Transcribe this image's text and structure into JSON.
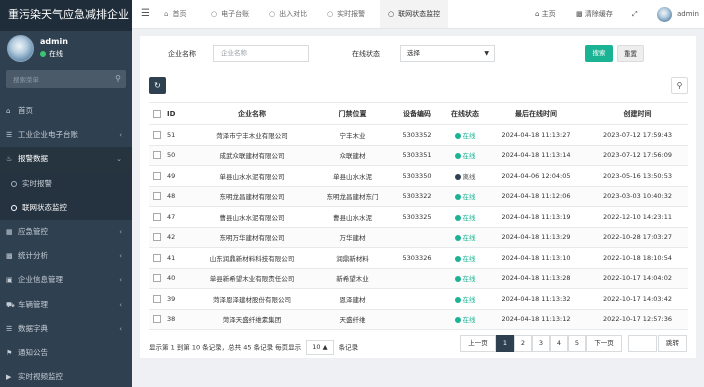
{
  "app": {
    "title": "重污染天气应急减排企业",
    "user": {
      "name": "admin",
      "status": "在线"
    }
  },
  "sidebar": {
    "search_placeholder": "搜索菜单",
    "items": [
      {
        "label": "首页",
        "icon": "home-icon",
        "has_arrow": false
      },
      {
        "label": "工业企业电子台账",
        "icon": "list-icon",
        "has_arrow": true
      },
      {
        "label": "报警数据",
        "icon": "bell-icon",
        "has_arrow": true,
        "expanded": true
      },
      {
        "label": "实时报警",
        "sub": true
      },
      {
        "label": "联网状态监控",
        "sub": true,
        "current": true
      },
      {
        "label": "应急管控",
        "icon": "grid-icon",
        "has_arrow": true
      },
      {
        "label": "统计分析",
        "icon": "bar-chart-icon",
        "has_arrow": true
      },
      {
        "label": "企业信息管理",
        "icon": "building-icon",
        "has_arrow": true
      },
      {
        "label": "车辆管理",
        "icon": "car-icon",
        "has_arrow": true
      },
      {
        "label": "数据字典",
        "icon": "database-icon",
        "has_arrow": true
      },
      {
        "label": "通知公告",
        "icon": "bullhorn-icon",
        "has_arrow": false
      },
      {
        "label": "实时视频监控",
        "icon": "video-icon",
        "has_arrow": false
      }
    ]
  },
  "topbar": {
    "tabs": [
      {
        "label": "首页",
        "icon": "home-icon"
      },
      {
        "label": "电子台账",
        "icon": "circle-icon"
      },
      {
        "label": "出入对比",
        "icon": "circle-icon"
      },
      {
        "label": "实时报警",
        "icon": "circle-icon"
      },
      {
        "label": "联网状态监控",
        "icon": "circle-icon",
        "active": true
      }
    ],
    "tools": {
      "home": "主页",
      "clear_cache": "清除缓存",
      "user": "admin"
    }
  },
  "filter": {
    "company_label": "企业名称",
    "company_placeholder": "企业名称",
    "status_label": "在线状态",
    "status_value": "选择",
    "search_button": "搜索",
    "reset_button": "重置"
  },
  "table": {
    "headers": [
      "ID",
      "企业名称",
      "门禁位置",
      "设备编码",
      "在线状态",
      "最后在线时间",
      "创建时间"
    ],
    "rows": [
      {
        "id": "51",
        "company": "菏泽市宁丰木业有限公司",
        "gate": "宁丰木业",
        "device": "5303352",
        "status": "在线",
        "last_online": "2024-04-18 11:13:27",
        "created": "2023-07-12 17:59:43"
      },
      {
        "id": "50",
        "company": "成武众联建材有限公司",
        "gate": "众联建材",
        "device": "5303351",
        "status": "在线",
        "last_online": "2024-04-18 11:13:14",
        "created": "2023-07-12 17:56:09"
      },
      {
        "id": "49",
        "company": "单县山水水泥有限公司",
        "gate": "单县山水水泥",
        "device": "5303350",
        "status": "离线",
        "last_online": "2024-04-06 12:04:05",
        "created": "2023-05-16 13:50:53"
      },
      {
        "id": "48",
        "company": "东明龙昌建材有限公司",
        "gate": "东明龙昌建材东门",
        "device": "5303322",
        "status": "在线",
        "last_online": "2024-04-18 11:12:06",
        "created": "2023-03-03 10:40:32"
      },
      {
        "id": "47",
        "company": "曹县山水水泥有限公司",
        "gate": "曹县山水水泥",
        "device": "5303325",
        "status": "在线",
        "last_online": "2024-04-18 11:13:19",
        "created": "2022-12-10 14:23:11"
      },
      {
        "id": "42",
        "company": "东明万华建材有限公司",
        "gate": "万华建材",
        "device": "",
        "status": "在线",
        "last_online": "2024-04-18 11:13:29",
        "created": "2022-10-28 17:03:27"
      },
      {
        "id": "41",
        "company": "山东润鼎新材料科技有限公司",
        "gate": "润鼎新材料",
        "device": "5303326",
        "status": "在线",
        "last_online": "2024-04-18 11:13:10",
        "created": "2022-10-18 18:10:54"
      },
      {
        "id": "40",
        "company": "单县新希望木业有限责任公司",
        "gate": "新希望木业",
        "device": "",
        "status": "在线",
        "last_online": "2024-04-18 11:13:28",
        "created": "2022-10-17 14:04:02"
      },
      {
        "id": "39",
        "company": "菏泽恩泽建材股份有限公司",
        "gate": "恩泽建材",
        "device": "",
        "status": "在线",
        "last_online": "2024-04-18 11:13:32",
        "created": "2022-10-17 14:03:42"
      },
      {
        "id": "38",
        "company": "菏泽天盛纤维素集团",
        "gate": "天盛纤维",
        "device": "",
        "status": "在线",
        "last_online": "2024-04-18 11:13:12",
        "created": "2022-10-17 12:57:36"
      }
    ]
  },
  "pagination": {
    "info_prefix": "显示第 1 到第 10 条记录，总共 45 条记录 每页显示",
    "page_size": "10",
    "info_suffix": "条记录",
    "prev": "上一页",
    "pages": [
      "1",
      "2",
      "3",
      "4",
      "5"
    ],
    "current_page": "1",
    "next": "下一页",
    "jump": "跳转"
  },
  "colors": {
    "sidebar_bg": "#2f4050",
    "accent": "#1ab394",
    "online": "#1ab394"
  }
}
